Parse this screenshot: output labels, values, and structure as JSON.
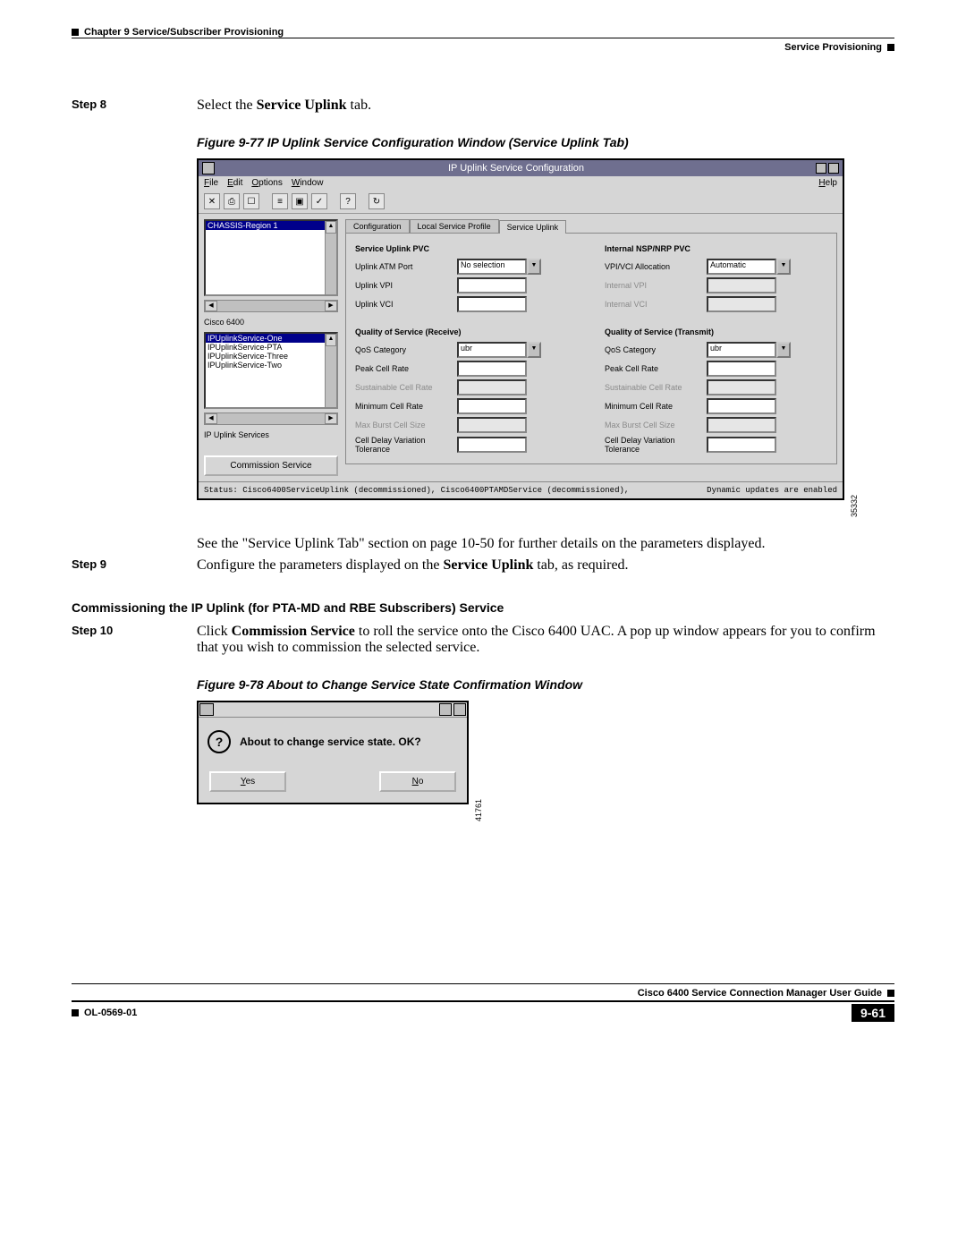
{
  "header": {
    "chapter": "Chapter 9    Service/Subscriber Provisioning",
    "section": "Service Provisioning"
  },
  "steps": {
    "s8_label": "Step 8",
    "s8_text_a": "Select the ",
    "s8_text_b": "Service Uplink",
    "s8_text_c": " tab.",
    "s9_label": "Step 9",
    "s9_text_a": "Configure the parameters displayed on the ",
    "s9_text_b": "Service Uplink",
    "s9_text_c": " tab, as required.",
    "s10_label": "Step 10",
    "s10_text_a": "Click ",
    "s10_text_b": "Commission Service",
    "s10_text_c": " to roll the service onto the Cisco 6400 UAC. A pop up window appears for you to confirm that you wish to commission the selected service."
  },
  "fig77_caption": "Figure 9-77   IP Uplink Service Configuration Window (Service Uplink Tab)",
  "fig77_sidenum": "35332",
  "see_text": "See the \"Service Uplink Tab\" section on page 10-50 for further details on the parameters displayed.",
  "section_head": "Commissioning the IP Uplink (for PTA-MD and RBE Subscribers) Service",
  "fig78_caption": "Figure 9-78   About to Change Service State Confirmation Window",
  "fig78_sidenum": "41761",
  "win": {
    "title": "IP Uplink Service Configuration",
    "menus": {
      "file": "File",
      "edit": "Edit",
      "options": "Options",
      "window": "Window",
      "help": "Help"
    },
    "left": {
      "chassis_sel": "CHASSIS-Region 1",
      "cisco": "Cisco 6400",
      "services_sel": "IPUplinkService-One",
      "services": [
        "IPUplinkService-PTA",
        "IPUplinkService-Three",
        "IPUplinkService-Two"
      ],
      "ip_uplink": "IP Uplink Services",
      "commission": "Commission Service"
    },
    "tabs": {
      "config": "Configuration",
      "local": "Local Service Profile",
      "uplink": "Service Uplink"
    },
    "groups": {
      "pvc_left": "Service Uplink PVC",
      "pvc_right": "Internal NSP/NRP PVC",
      "qos_rx": "Quality of Service (Receive)",
      "qos_tx": "Quality of Service (Transmit)"
    },
    "fields": {
      "uplink_atm": "Uplink ATM Port",
      "uplink_atm_val": "No selection",
      "uplink_vpi": "Uplink VPI",
      "uplink_vci": "Uplink VCI",
      "vpivci": "VPI/VCI Allocation",
      "vpivci_val": "Automatic",
      "int_vpi": "Internal VPI",
      "int_vci": "Internal VCI",
      "qos_cat": "QoS Category",
      "qos_cat_val": "ubr",
      "peak": "Peak Cell Rate",
      "sustain": "Sustainable Cell Rate",
      "min": "Minimum Cell Rate",
      "burst": "Max Burst Cell Size",
      "cdvt": "Cell Delay Variation Tolerance"
    },
    "status_left": "Status: Cisco6400ServiceUplink (decommissioned), Cisco6400PTAMDService (decommissioned),",
    "status_right": "Dynamic updates are enabled"
  },
  "dlg": {
    "msg": "About to change service state. OK?",
    "yes": "Yes",
    "no": "No"
  },
  "footer": {
    "guide": "Cisco 6400 Service Connection Manager User Guide",
    "docnum": "OL-0569-01",
    "pagenum": "9-61"
  }
}
